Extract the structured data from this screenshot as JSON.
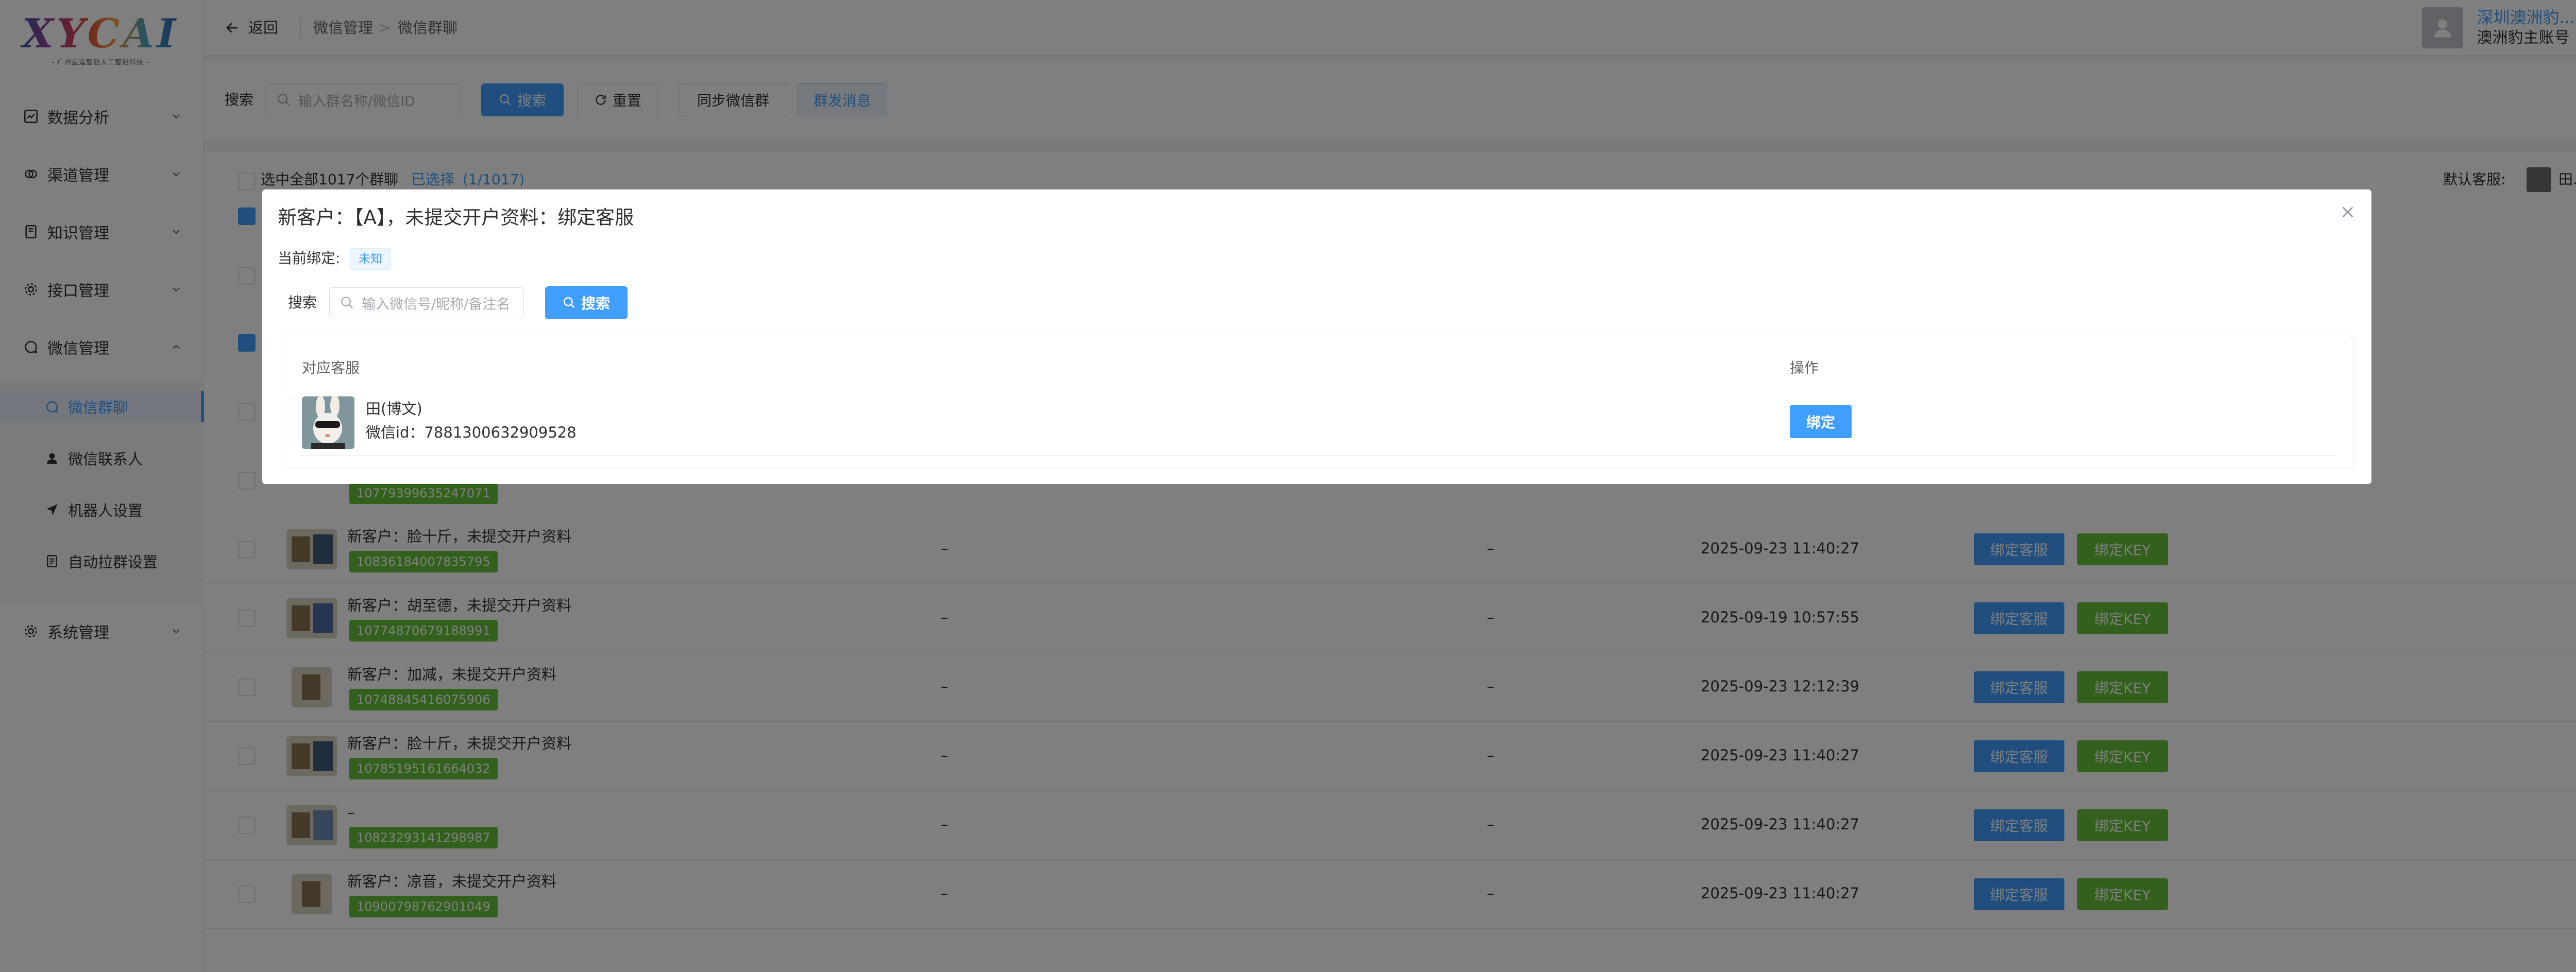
{
  "logo": {
    "mark": "XYCAI",
    "sub": "- 广州星遥智能人工智能科技 -"
  },
  "sidebar": {
    "groups": [
      {
        "label": "数据分析",
        "icon": "chart-icon"
      },
      {
        "label": "渠道管理",
        "icon": "channel-icon"
      },
      {
        "label": "知识管理",
        "icon": "book-icon"
      },
      {
        "label": "接口管理",
        "icon": "gear-icon"
      },
      {
        "label": "微信管理",
        "icon": "chat-icon"
      },
      {
        "label": "系统管理",
        "icon": "settings-icon"
      }
    ],
    "wechat_sub": [
      {
        "label": "微信群聊",
        "icon": "chat-icon",
        "active": true
      },
      {
        "label": "微信联系人",
        "icon": "user-icon"
      },
      {
        "label": "机器人设置",
        "icon": "send-icon"
      },
      {
        "label": "自动拉群设置",
        "icon": "doc-icon"
      }
    ]
  },
  "header": {
    "back_label": "返回",
    "breadcrumb": [
      "微信管理",
      "微信群聊"
    ],
    "user_name": "深圳澳洲豹...",
    "user_account": "澳洲豹主账号"
  },
  "search": {
    "label": "搜索",
    "placeholder": "输入群名称/微信ID",
    "search_btn": "搜索",
    "reset_btn": "重置",
    "sync_btn": "同步微信群",
    "broadcast_btn": "群发消息"
  },
  "table": {
    "select_all_label": "选中全部1017个群聊",
    "selected_label": "已选择",
    "selected_count": "(1/1017)",
    "default_agent_label": "默认客服:",
    "default_agent_name": "田...",
    "partial_tag": "10779399635247071",
    "rows": [
      {
        "name": "新客户：脸十斤，未提交开户资料",
        "id": "10836184007835795",
        "c1": "–",
        "c2": "–",
        "time": "2025-09-23 11:40:27"
      },
      {
        "name": "新客户：胡至德，未提交开户资料",
        "id": "10774870679188991",
        "c1": "–",
        "c2": "–",
        "time": "2025-09-19 10:57:55"
      },
      {
        "name": "新客户：加减，未提交开户资料",
        "id": "10748845416075906",
        "c1": "–",
        "c2": "–",
        "time": "2025-09-23 12:12:39"
      },
      {
        "name": "新客户：脸十斤，未提交开户资料",
        "id": "10785195161664032",
        "c1": "–",
        "c2": "–",
        "time": "2025-09-23 11:40:27"
      },
      {
        "name": "–",
        "id": "10823293141298987",
        "c1": "–",
        "c2": "–",
        "time": "2025-09-23 11:40:27"
      },
      {
        "name": "新客户：凉音，未提交开户资料",
        "id": "10900798762901049",
        "c1": "–",
        "c2": "–",
        "time": "2025-09-23 11:40:27"
      }
    ],
    "bind_agent_btn": "绑定客服",
    "bind_key_btn": "绑定KEY"
  },
  "dialog": {
    "title": "新客户：【A】，未提交开户资料：绑定客服",
    "current_label": "当前绑定:",
    "current_value": "未知",
    "search_label": "搜索",
    "search_placeholder": "输入微信号/昵称/备注名",
    "search_btn": "搜索",
    "col_agent": "对应客服",
    "col_action": "操作",
    "agent_name": "田(博文)",
    "agent_id_label": "微信id：",
    "agent_id": "7881300632909528",
    "bind_btn": "绑定"
  },
  "colors": {
    "primary": "#409eff",
    "success": "#67c23a",
    "overlay": "rgba(0,0,0,0.5)"
  }
}
